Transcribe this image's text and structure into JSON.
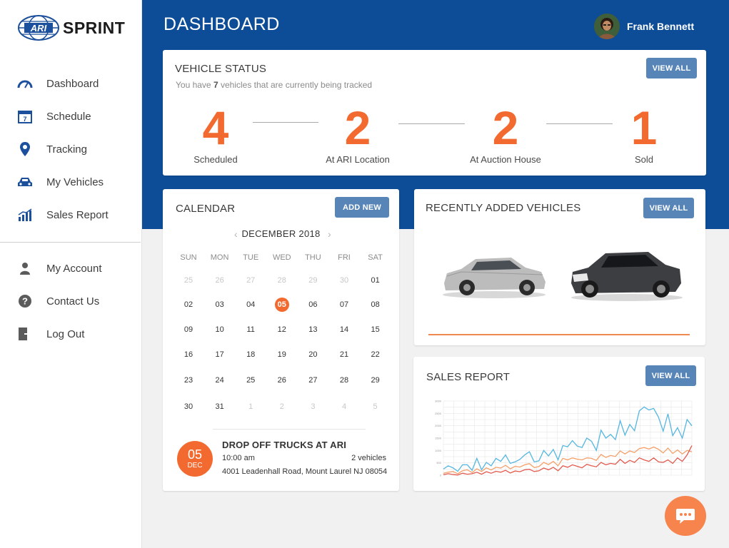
{
  "brand": {
    "name": "SPRINT",
    "logo_text": "ARI"
  },
  "sidebar": {
    "items": [
      {
        "label": "Dashboard",
        "icon": "speedometer-icon"
      },
      {
        "label": "Schedule",
        "icon": "calendar-icon"
      },
      {
        "label": "Tracking",
        "icon": "map-pin-icon"
      },
      {
        "label": "My Vehicles",
        "icon": "car-icon"
      },
      {
        "label": "Sales Report",
        "icon": "bar-chart-icon"
      }
    ],
    "secondary": [
      {
        "label": "My Account",
        "icon": "user-icon"
      },
      {
        "label": "Contact Us",
        "icon": "question-icon"
      },
      {
        "label": "Log Out",
        "icon": "logout-icon"
      }
    ]
  },
  "header": {
    "title": "DASHBOARD",
    "user_name": "Frank Bennett"
  },
  "vehicle_status": {
    "title": "VEHICLE STATUS",
    "view_all": "VIEW ALL",
    "subtitle_pre": "You have ",
    "count": "7",
    "subtitle_post": " vehicles that are currently being tracked",
    "stats": [
      {
        "value": "4",
        "label": "Scheduled"
      },
      {
        "value": "2",
        "label": "At ARI Location"
      },
      {
        "value": "2",
        "label": "At Auction House"
      },
      {
        "value": "1",
        "label": "Sold"
      }
    ]
  },
  "calendar": {
    "title": "CALENDAR",
    "add_new": "ADD NEW",
    "month": "DECEMBER 2018",
    "weekdays": [
      "SUN",
      "MON",
      "TUE",
      "WED",
      "THU",
      "FRI",
      "SAT"
    ],
    "weeks": [
      [
        "25",
        "26",
        "27",
        "28",
        "29",
        "30",
        "01"
      ],
      [
        "02",
        "03",
        "04",
        "05",
        "06",
        "07",
        "08"
      ],
      [
        "09",
        "10",
        "11",
        "12",
        "13",
        "14",
        "15"
      ],
      [
        "16",
        "17",
        "18",
        "19",
        "20",
        "21",
        "22"
      ],
      [
        "23",
        "24",
        "25",
        "26",
        "27",
        "28",
        "29"
      ],
      [
        "30",
        "31",
        "1",
        "2",
        "3",
        "4",
        "5"
      ]
    ],
    "selected": "05",
    "event": {
      "day": "05",
      "month": "DEC",
      "title": "DROP OFF TRUCKS AT ARI",
      "time": "10:00 am",
      "count": "2 vehicles",
      "address": "4001 Leadenhall Road, Mount Laurel NJ 08054"
    }
  },
  "recent_vehicles": {
    "title": "RECENTLY ADDED VEHICLES",
    "view_all": "VIEW ALL"
  },
  "sales_report": {
    "title": "SALES REPORT",
    "view_all": "VIEW ALL"
  },
  "colors": {
    "primary": "#0d4d97",
    "accent": "#f26a30",
    "button": "#5785b8"
  },
  "chart_data": {
    "type": "line",
    "ylim": [
      0,
      3000
    ],
    "yticks": [
      "0",
      "500",
      "1000",
      "1500",
      "2000",
      "2500",
      "3000"
    ],
    "series": [
      {
        "color": "#55b6e0",
        "values": [
          250,
          380,
          300,
          160,
          420,
          420,
          200,
          680,
          220,
          520,
          380,
          680,
          560,
          820,
          480,
          540,
          640,
          820,
          950,
          540,
          580,
          1000,
          780,
          1040,
          620,
          1200,
          1150,
          1400,
          1180,
          1120,
          1500,
          1370,
          1000,
          1820,
          1500,
          1650,
          1440,
          2200,
          1620,
          2050,
          1800,
          2600,
          2760,
          2640,
          2700,
          2350,
          1780,
          2480,
          1600,
          1920,
          1500,
          2250,
          2000
        ]
      },
      {
        "color": "#f5a06a",
        "values": [
          80,
          120,
          150,
          60,
          180,
          220,
          110,
          260,
          150,
          300,
          210,
          320,
          290,
          400,
          260,
          360,
          330,
          420,
          470,
          310,
          350,
          520,
          430,
          560,
          380,
          680,
          620,
          700,
          650,
          620,
          700,
          680,
          600,
          840,
          720,
          800,
          760,
          980,
          860,
          980,
          920,
          1080,
          1120,
          1060,
          1140,
          1050,
          900,
          1100,
          880,
          1020,
          860,
          1000,
          950
        ]
      },
      {
        "color": "#e35a4e",
        "values": [
          20,
          60,
          30,
          10,
          80,
          40,
          60,
          120,
          40,
          140,
          80,
          160,
          120,
          200,
          90,
          170,
          140,
          220,
          240,
          150,
          180,
          290,
          220,
          320,
          180,
          380,
          320,
          420,
          360,
          300,
          440,
          380,
          340,
          520,
          420,
          480,
          440,
          640,
          480,
          600,
          520,
          700,
          620,
          560,
          700,
          540,
          520,
          620,
          480,
          700,
          560,
          820,
          1200
        ]
      }
    ]
  }
}
